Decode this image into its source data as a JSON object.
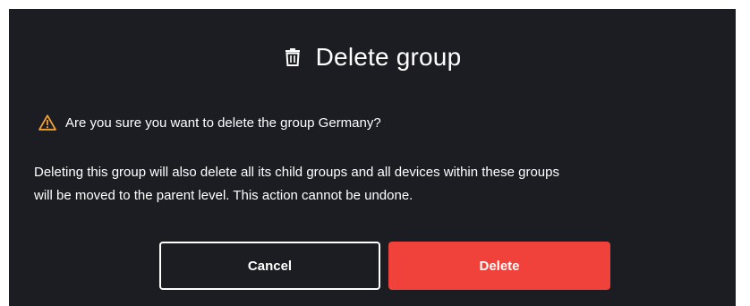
{
  "dialog": {
    "title": "Delete group",
    "title_icon": "trash-icon",
    "warning": {
      "icon": "warning-triangle-icon",
      "icon_color": "#f0a23a",
      "text": "Are you sure you want to delete the group Germany?"
    },
    "body_line1": "Deleting this group will also delete all its child groups and all devices within these groups",
    "body_line2": "will be moved to the parent level. This action cannot be undone.",
    "cancel_label": "Cancel",
    "delete_label": "Delete"
  },
  "colors": {
    "background": "#1b1d22",
    "danger": "#f0423a",
    "text": "#ffffff"
  }
}
